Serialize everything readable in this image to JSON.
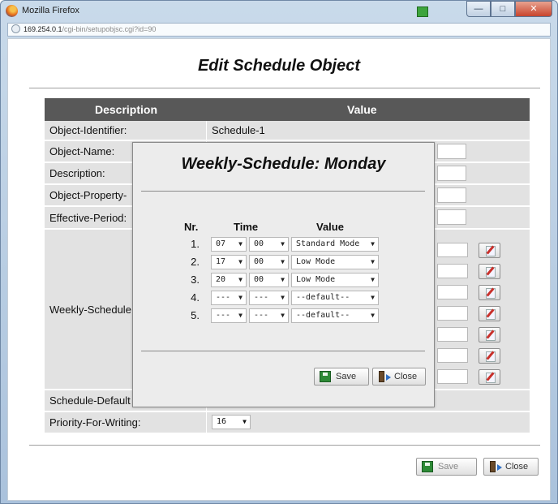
{
  "window": {
    "title": "Mozilla Firefox",
    "buttons": {
      "minimize": "—",
      "maximize": "□",
      "close": "✕"
    }
  },
  "urlbar": {
    "host": "169.254.0.1",
    "path": "/cgi-bin/setupobjsc.cgi?id=90"
  },
  "page": {
    "title": "Edit Schedule Object",
    "table": {
      "headers": {
        "description": "Description",
        "value": "Value"
      },
      "rows": [
        {
          "label": "Object-Identifier:",
          "value": "Schedule-1"
        },
        {
          "label": "Object-Name:"
        },
        {
          "label": "Description:"
        },
        {
          "label": "Object-Property-"
        },
        {
          "label": "Effective-Period:"
        },
        {
          "label": "Weekly-Schedule"
        },
        {
          "label": "Schedule-Default"
        },
        {
          "label": "Priority-For-Writing:",
          "value": "16"
        }
      ]
    },
    "buttons": {
      "save": "Save",
      "close": "Close"
    }
  },
  "dialog": {
    "title": "Weekly-Schedule: Monday",
    "headers": {
      "nr": "Nr.",
      "time": "Time",
      "value": "Value"
    },
    "rows": [
      {
        "nr": "1.",
        "hour": "07",
        "minute": "00",
        "value": "Standard Mode"
      },
      {
        "nr": "2.",
        "hour": "17",
        "minute": "00",
        "value": "Low Mode"
      },
      {
        "nr": "3.",
        "hour": "20",
        "minute": "00",
        "value": "Low Mode"
      },
      {
        "nr": "4.",
        "hour": "---",
        "minute": "---",
        "value": "--default--"
      },
      {
        "nr": "5.",
        "hour": "---",
        "minute": "---",
        "value": "--default--"
      }
    ],
    "buttons": {
      "save": "Save",
      "close": "Close"
    }
  }
}
